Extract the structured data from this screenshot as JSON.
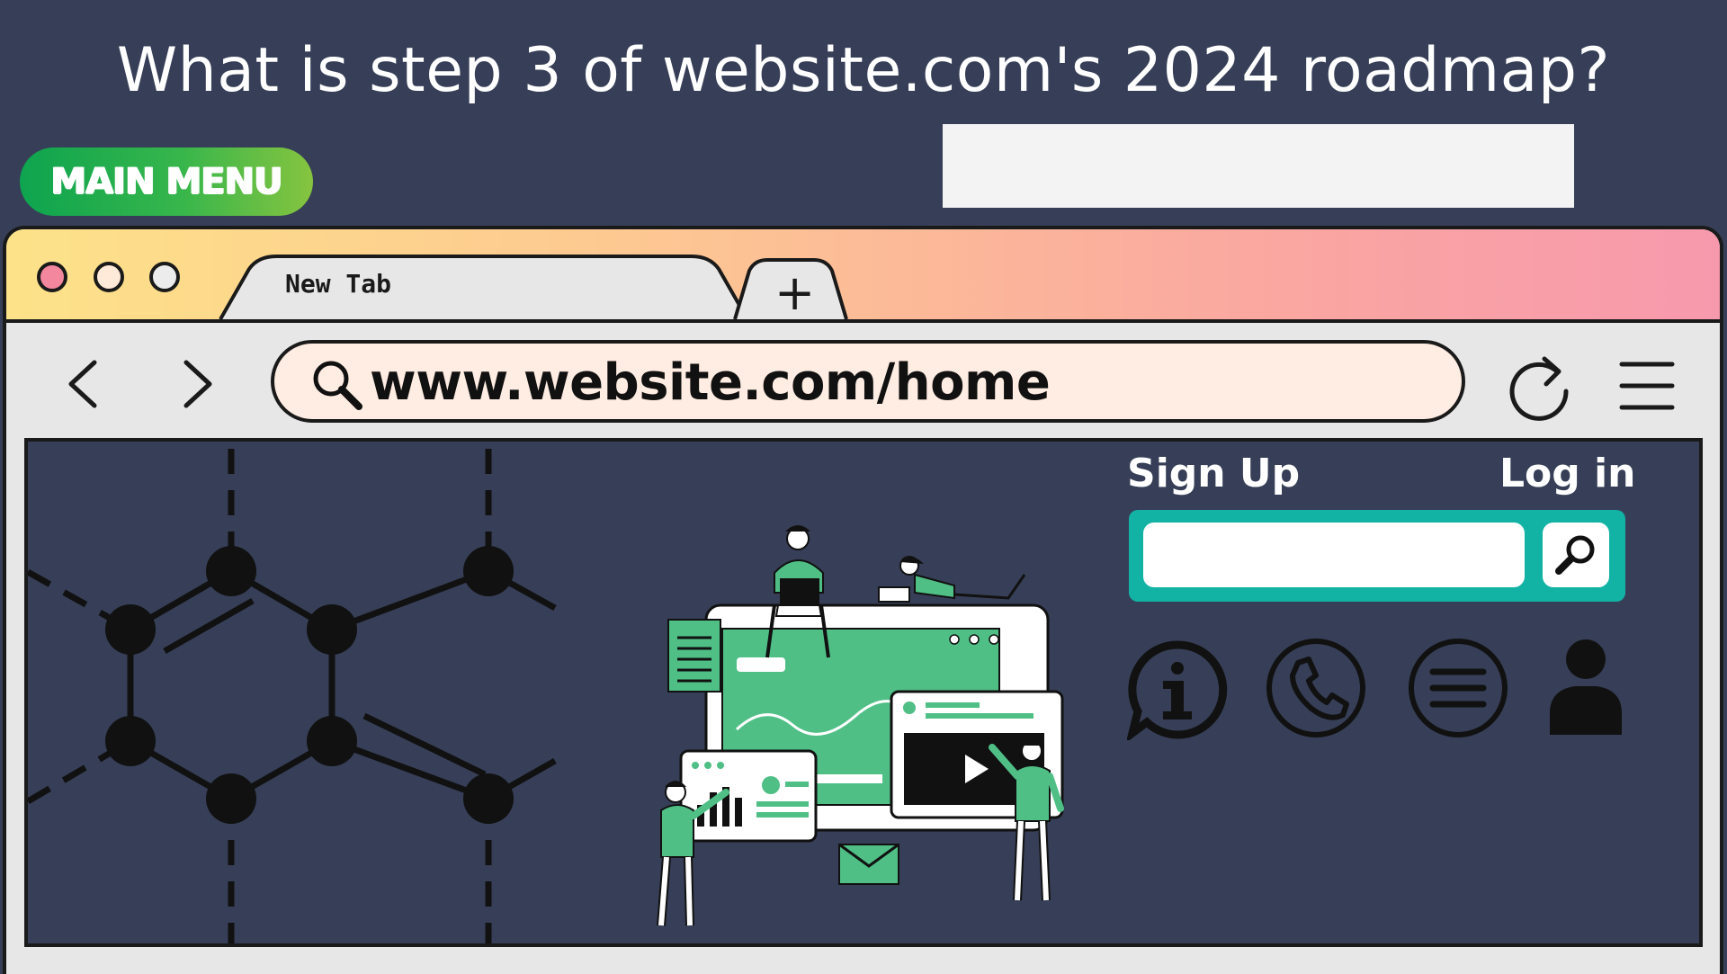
{
  "question": "What is step 3 of website.com's 2024 roadmap?",
  "main_menu": {
    "label": "MAIN MENU"
  },
  "browser": {
    "tab": {
      "label": "New Tab"
    },
    "new_tab": {
      "label": "+"
    },
    "address": {
      "url": "www.website.com/home"
    }
  },
  "page": {
    "signup": "Sign Up",
    "login": "Log in",
    "search": {
      "placeholder": ""
    },
    "icons": [
      "info-icon",
      "phone-icon",
      "menu-icon",
      "user-icon"
    ]
  },
  "colors": {
    "background": "#363f57",
    "accent_teal": "#12b3a5",
    "illustration_green": "#4fbf86",
    "menu_green": "#0ea44f"
  }
}
